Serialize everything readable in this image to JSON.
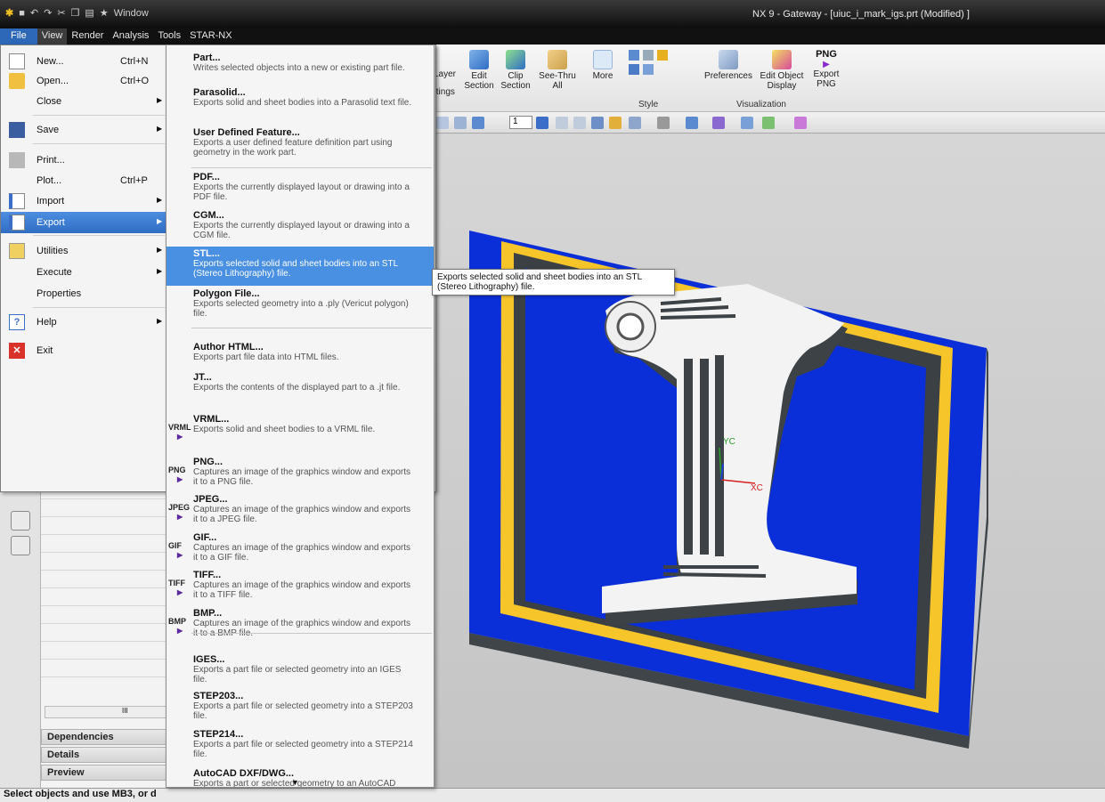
{
  "window": {
    "title": "NX 9 - Gateway - [uiuc_i_mark_igs.prt (Modified) ]",
    "qat_window_label": "Window"
  },
  "menubar": [
    "File",
    "View",
    "Render",
    "Analysis",
    "Tools",
    "STAR-NX"
  ],
  "ribbon": {
    "layer_label": "Layer",
    "settings_label": "ttings",
    "edit_section": "Edit Section",
    "clip_section": "Clip Section",
    "see_thru": "See-Thru All",
    "more": "More",
    "style_group": "Style",
    "preferences": "Preferences",
    "edit_object_display": "Edit Object Display",
    "export_png": "Export PNG",
    "png_icon_label": "PNG",
    "visualization_group": "Visualization",
    "layer_number": "1"
  },
  "file_menu": {
    "items": [
      {
        "label": "New...",
        "shortcut": "Ctrl+N",
        "arrow": ""
      },
      {
        "label": "Open...",
        "shortcut": "Ctrl+O",
        "arrow": ""
      },
      {
        "label": "Close",
        "shortcut": "",
        "arrow": "▶"
      },
      {
        "label": "Save",
        "shortcut": "",
        "arrow": "▶"
      },
      {
        "label": "Print...",
        "shortcut": "",
        "arrow": ""
      },
      {
        "label": "Plot...",
        "shortcut": "Ctrl+P",
        "arrow": ""
      },
      {
        "label": "Import",
        "shortcut": "",
        "arrow": "▶"
      },
      {
        "label": "Export",
        "shortcut": "",
        "arrow": "▶"
      },
      {
        "label": "Utilities",
        "shortcut": "",
        "arrow": "▶"
      },
      {
        "label": "Execute",
        "shortcut": "",
        "arrow": "▶"
      },
      {
        "label": "Properties",
        "shortcut": "",
        "arrow": ""
      },
      {
        "label": "Help",
        "shortcut": "",
        "arrow": "▶"
      },
      {
        "label": "Exit",
        "shortcut": "",
        "arrow": ""
      }
    ]
  },
  "export_menu": {
    "items": [
      {
        "title": "Part...",
        "desc": "Writes selected objects into a new or existing part file.",
        "icon": ""
      },
      {
        "title": "Parasolid...",
        "desc": "Exports solid and sheet bodies into a Parasolid text file.",
        "icon": ""
      },
      {
        "title": "User Defined Feature...",
        "desc": "Exports a user defined feature definition part using geometry in the work part.",
        "icon": ""
      },
      {
        "title": "PDF...",
        "desc": "Exports the currently displayed layout or drawing into a PDF file.",
        "icon": ""
      },
      {
        "title": "CGM...",
        "desc": "Exports the currently displayed layout or drawing into a CGM file.",
        "icon": ""
      },
      {
        "title": "STL...",
        "desc": "Exports selected solid and sheet bodies into an STL (Stereo Lithography) file.",
        "icon": ""
      },
      {
        "title": "Polygon File...",
        "desc": "Exports selected geometry into a .ply (Vericut polygon) file.",
        "icon": ""
      },
      {
        "title": "Author HTML...",
        "desc": "Exports part file data into HTML files.",
        "icon": ""
      },
      {
        "title": "JT...",
        "desc": "Exports the contents of the displayed part to a .jt file.",
        "icon": ""
      },
      {
        "title": "VRML...",
        "desc": "Exports solid and sheet bodies to a VRML file.",
        "icon": "VRML"
      },
      {
        "title": "PNG...",
        "desc": "Captures an image of the graphics window and exports it to a PNG file.",
        "icon": "PNG"
      },
      {
        "title": "JPEG...",
        "desc": "Captures an image of the graphics window and exports it to a JPEG file.",
        "icon": "JPEG"
      },
      {
        "title": "GIF...",
        "desc": "Captures an image of the graphics window and exports it to a GIF file.",
        "icon": "GIF"
      },
      {
        "title": "TIFF...",
        "desc": "Captures an image of the graphics window and exports it to a TIFF file.",
        "icon": "TIFF"
      },
      {
        "title": "BMP...",
        "desc": "Captures an image of the graphics window and exports it to a BMP file.",
        "icon": "BMP"
      },
      {
        "title": "IGES...",
        "desc": "Exports a part file or selected geometry into an IGES file.",
        "icon": ""
      },
      {
        "title": "STEP203...",
        "desc": "Exports a part file or selected geometry into a STEP203 file.",
        "icon": ""
      },
      {
        "title": "STEP214...",
        "desc": "Exports a part file or selected geometry into a STEP214 file.",
        "icon": ""
      },
      {
        "title": "AutoCAD DXF/DWG...",
        "desc": "Exports a part or selected geometry to an AutoCAD",
        "icon": ""
      }
    ]
  },
  "tooltip": "Exports selected solid and sheet bodies into an STL (Stereo Lithography) file.",
  "navigator": {
    "sections": [
      "Dependencies",
      "Details",
      "Preview"
    ],
    "scroll_label": "III"
  },
  "axes": {
    "x": "XC",
    "y": "YC"
  },
  "statusbar": "Select objects and use MB3, or d",
  "colors": {
    "accent": "#2f6dc4",
    "plate_blue": "#0a2ed8",
    "frame_yellow": "#f5c52a",
    "shadow_gray": "#3f4548"
  }
}
